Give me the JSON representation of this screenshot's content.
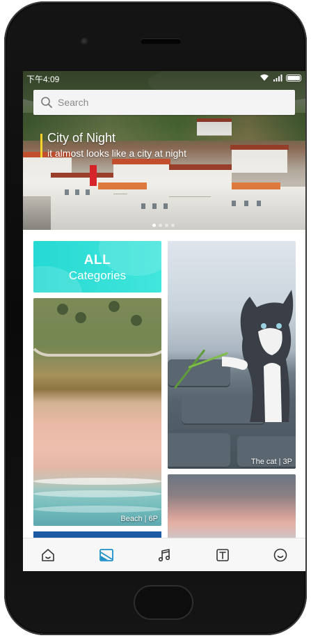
{
  "status_bar": {
    "time": "下午4:09"
  },
  "search": {
    "placeholder": "Search"
  },
  "banner": {
    "title": "City of Night",
    "subtitle": "it almost looks like a city at night",
    "page_indicator": {
      "count": 4,
      "active": 0
    }
  },
  "grid": {
    "all_tile": {
      "title": "ALL",
      "subtitle": "Categories"
    },
    "beach_tile": {
      "label": "Beach | 6P"
    },
    "cat_tile": {
      "label": "The cat | 3P"
    }
  },
  "tab_bar": {
    "tabs": [
      {
        "icon": "home-icon",
        "active": false
      },
      {
        "icon": "wallpaper-icon",
        "active": true
      },
      {
        "icon": "music-icon",
        "active": false
      },
      {
        "icon": "font-icon",
        "active": false
      },
      {
        "icon": "smiley-icon",
        "active": false
      }
    ]
  },
  "colors": {
    "accent": "#1e90c8",
    "tile_cyan": "#2fdfd6",
    "caption_bar": "#f3d22b"
  }
}
